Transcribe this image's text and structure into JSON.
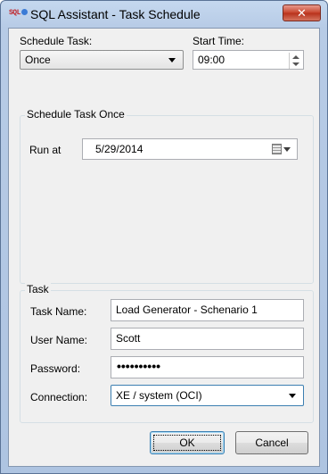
{
  "window": {
    "title": "SQL Assistant - Task Schedule",
    "icon_text": "SQL",
    "close_label": "✕"
  },
  "schedule": {
    "schedule_task_label": "Schedule Task:",
    "schedule_task_value": "Once",
    "start_time_label": "Start Time:",
    "start_time_value": "09:00"
  },
  "once_group": {
    "title": "Schedule Task Once",
    "run_at_label": "Run at",
    "run_at_value": "5/29/2014"
  },
  "task_group": {
    "title": "Task",
    "task_name_label": "Task Name:",
    "task_name_value": "Load Generator - Schenario 1",
    "user_name_label": "User Name:",
    "user_name_value": "Scott",
    "password_label": "Password:",
    "password_value": "••••••••••",
    "connection_label": "Connection:",
    "connection_value": "XE / system (OCI)"
  },
  "buttons": {
    "ok": "OK",
    "cancel": "Cancel"
  },
  "colors": {
    "titlebar": "#b7cbe6",
    "close": "#c7432b",
    "dialog_bg": "#f0f0f0"
  }
}
